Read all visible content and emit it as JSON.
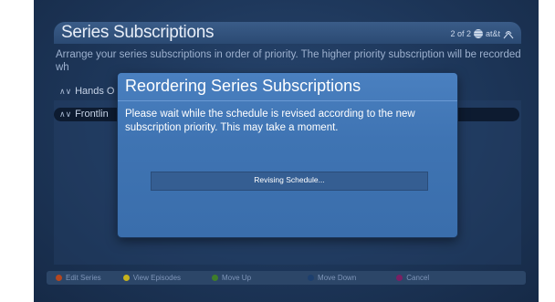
{
  "header": {
    "title": "Series Subscriptions",
    "page_indicator": "2 of 2",
    "carrier": "at&t",
    "network_icon": "att-globe-icon"
  },
  "instructions": "Arrange your series subscriptions in order of priority. The higher priority subscription will be recorded wh",
  "list": {
    "items": [
      {
        "arrows": "∧∨",
        "label": "Hands O"
      },
      {
        "arrows": "∧∨",
        "label": "Frontlin"
      }
    ]
  },
  "dialog": {
    "title": "Reordering Series Subscriptions",
    "message": "Please wait while the schedule is revised according to the new subscription priority. This may take a moment.",
    "progress_label": "Revising Schedule..."
  },
  "footer": {
    "buttons": [
      {
        "label": "Edit Series",
        "color": "#b5471f"
      },
      {
        "label": "View Episodes",
        "color": "#c6b21c"
      },
      {
        "label": "Move Up",
        "color": "#3f7d2a"
      },
      {
        "label": "Move Down",
        "color": "#1d3f6e"
      },
      {
        "label": "Cancel",
        "color": "#7a1f63"
      }
    ]
  }
}
